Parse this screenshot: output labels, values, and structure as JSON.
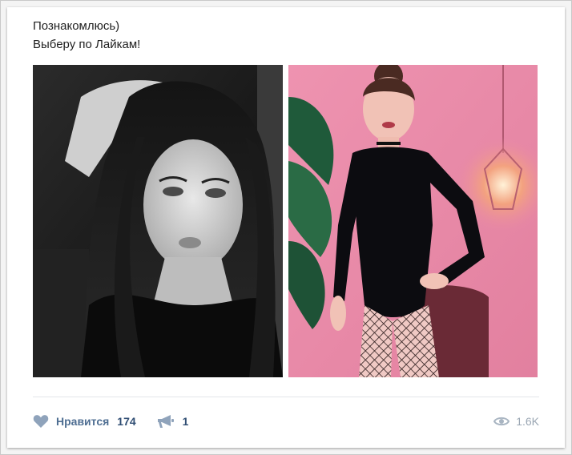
{
  "post": {
    "text_line_1": "Познакомлюсь)",
    "text_line_2": "Выберу по Лайкам!"
  },
  "photos": [
    {
      "alt": "black-and-white selfie of a woman with long dark hair"
    },
    {
      "alt": "woman in black bodysuit and fishnet tights against pink wall"
    }
  ],
  "footer": {
    "like_label": "Нравится",
    "like_count": "174",
    "share_count": "1",
    "views_count": "1.6K"
  },
  "icons": {
    "like": "heart-icon",
    "share": "megaphone-icon",
    "views": "eye-icon"
  },
  "colors": {
    "accent": "#4e6e92",
    "icon": "#8fa3bb",
    "muted": "#9aa6b3",
    "pink_wall": "#e98aa6"
  }
}
